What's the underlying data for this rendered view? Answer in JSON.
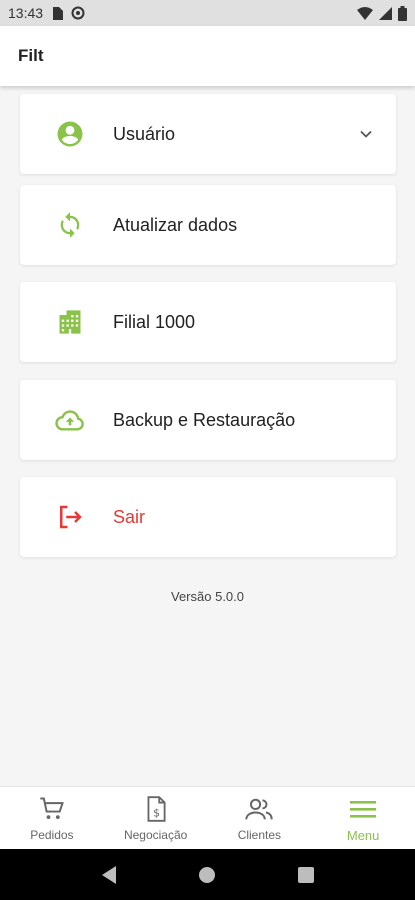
{
  "status_bar": {
    "time": "13:43"
  },
  "app_bar": {
    "title": "Filt"
  },
  "menu": {
    "items": [
      {
        "label": "Usuário",
        "icon": "account-circle-icon",
        "has_chevron": true
      },
      {
        "label": "Atualizar dados",
        "icon": "sync-icon"
      },
      {
        "label": "Filial 1000",
        "icon": "building-icon"
      },
      {
        "label": "Backup e Restauração",
        "icon": "cloud-upload-icon"
      },
      {
        "label": "Sair",
        "icon": "logout-icon",
        "danger": true
      }
    ]
  },
  "version": "Versão 5.0.0",
  "bottom_nav": {
    "items": [
      {
        "label": "Pedidos",
        "icon": "cart-icon"
      },
      {
        "label": "Negociação",
        "icon": "invoice-dollar-icon"
      },
      {
        "label": "Clientes",
        "icon": "people-icon"
      },
      {
        "label": "Menu",
        "icon": "hamburger-icon",
        "active": true
      }
    ]
  },
  "colors": {
    "accent": "#8bc34a",
    "danger": "#e53935"
  }
}
